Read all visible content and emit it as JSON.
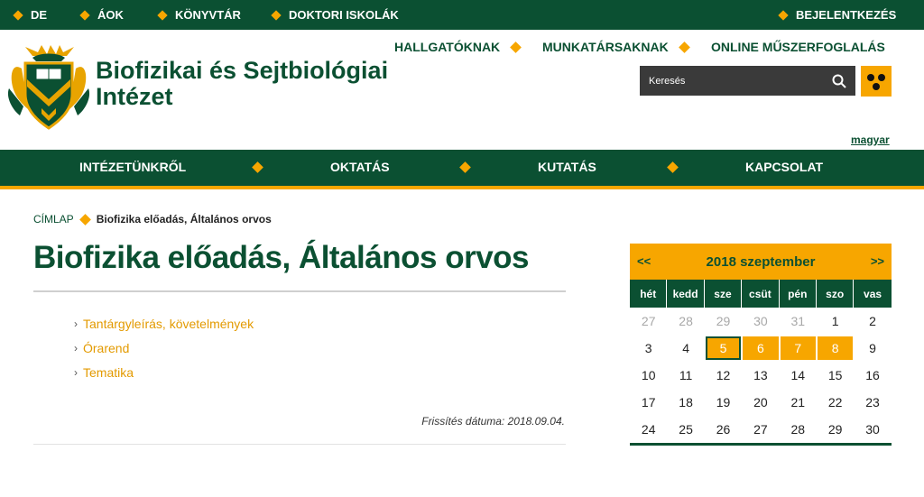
{
  "topbar": {
    "links": [
      "DE",
      "ÁOK",
      "KÖNYVTÁR",
      "DOKTORI ISKOLÁK"
    ],
    "login": "BEJELENTKEZÉS"
  },
  "header": {
    "title_line1": "Biofizikai és Sejtbiológiai",
    "title_line2": "Intézet",
    "secondary_nav": [
      "HALLGATÓKNAK",
      "MUNKATÁRSAKNAK",
      "ONLINE MŰSZERFOGLALÁS"
    ],
    "search_placeholder": "Keresés",
    "language": "magyar"
  },
  "main_nav": [
    "INTÉZETÜNKRŐL",
    "OKTATÁS",
    "KUTATÁS",
    "KAPCSOLAT"
  ],
  "breadcrumb": {
    "home": "CÍMLAP",
    "current": "Biofizika előadás, Általános orvos"
  },
  "page": {
    "title": "Biofizika előadás, Általános orvos",
    "links": [
      "Tantárgyleírás, követelmények",
      "Órarend",
      "Tematika"
    ],
    "updated": "Frissítés dátuma: 2018.09.04."
  },
  "calendar": {
    "month": "2018 szeptember",
    "prev": "<<",
    "next": ">>",
    "weekdays": [
      "hét",
      "kedd",
      "sze",
      "csüt",
      "pén",
      "szo",
      "vas"
    ],
    "weeks": [
      [
        "27",
        "28",
        "29",
        "30",
        "31",
        "1",
        "2"
      ],
      [
        "3",
        "4",
        "5",
        "6",
        "7",
        "8",
        "9"
      ],
      [
        "10",
        "11",
        "12",
        "13",
        "14",
        "15",
        "16"
      ],
      [
        "17",
        "18",
        "19",
        "20",
        "21",
        "22",
        "23"
      ],
      [
        "24",
        "25",
        "26",
        "27",
        "28",
        "29",
        "30"
      ]
    ],
    "other_month_days": [
      "27",
      "28",
      "29",
      "30",
      "31"
    ],
    "today": "5",
    "event_days": [
      "6",
      "7",
      "8"
    ]
  },
  "colors": {
    "brand_green": "#0b5032",
    "accent_orange": "#f7a600"
  }
}
